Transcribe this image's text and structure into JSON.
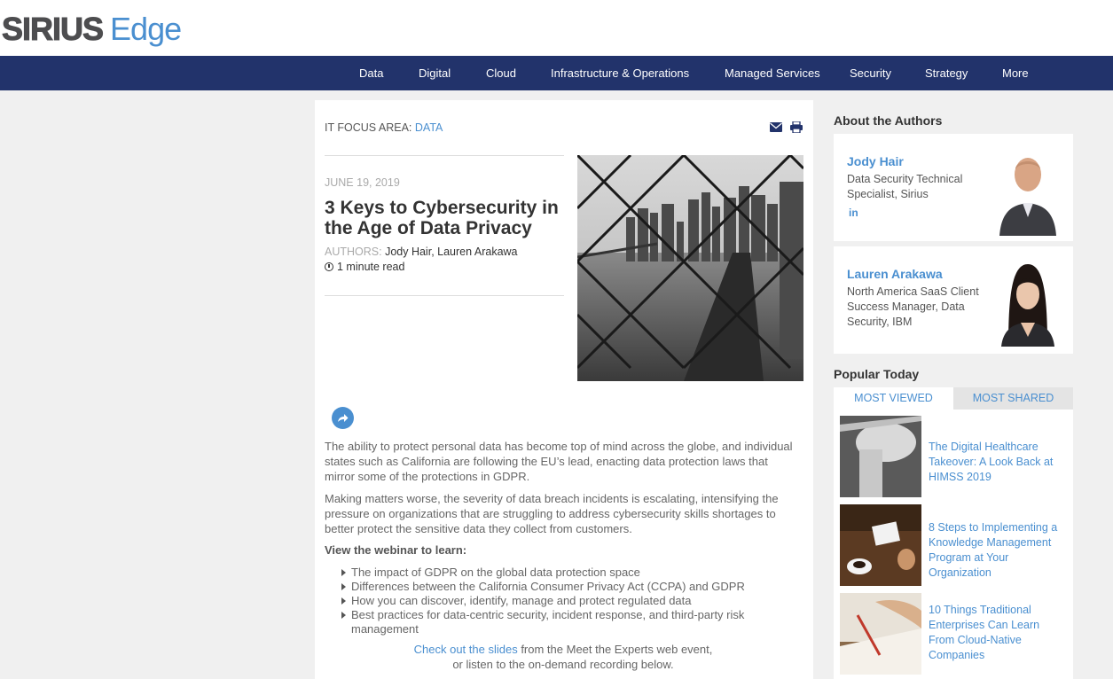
{
  "brand": {
    "name_bold": "SIRIUS",
    "name_light": "Edge"
  },
  "nav": {
    "items": [
      {
        "label": "Data"
      },
      {
        "label": "Digital"
      },
      {
        "label": "Cloud"
      },
      {
        "label": "Infrastructure & Operations"
      },
      {
        "label": "Managed Services"
      },
      {
        "label": "Security"
      },
      {
        "label": "Strategy"
      },
      {
        "label": "More"
      }
    ]
  },
  "article": {
    "focus_label": "IT FOCUS AREA:",
    "focus_value": "DATA",
    "date": "JUNE 19, 2019",
    "title": "3 Keys to Cybersecurity in the Age of Data Privacy",
    "authors_label": "AUTHORS:",
    "author_1": "Jody Hair",
    "author_sep": ",",
    "author_2": "Lauren Arakawa",
    "read_time": "1 minute read",
    "paragraph_1": "The ability to protect personal data has become top of mind across the globe, and individual states such as California are following the EU’s lead, enacting data protection laws that mirror some of the protections in GDPR.",
    "paragraph_2": "Making matters worse, the severity of data breach incidents is escalating, intensifying the pressure on organizations that are struggling to address cybersecurity skills shortages to better protect the sensitive data they collect from customers.",
    "learn_heading": "View the webinar to learn:",
    "bullets": [
      "The impact of GDPR on the global data protection space",
      "Differences between the California Consumer Privacy Act (CCPA) and GDPR",
      "How you can discover, identify, manage and protect regulated data",
      "Best practices for data-centric security, incident response, and third-party risk management"
    ],
    "cta_link": "Check out the slides",
    "cta_rest": " from the Meet the Experts web event,",
    "cta_line2": "or listen to the on-demand recording below."
  },
  "sidebar": {
    "authors_heading": "About the Authors",
    "authors": [
      {
        "name": "Jody Hair",
        "role": "Data Security Technical Specialist, Sirius",
        "social": "in"
      },
      {
        "name": "Lauren Arakawa",
        "role": "North America SaaS Client Success Manager, Data Security, IBM"
      }
    ],
    "popular_heading": "Popular Today",
    "tabs": [
      {
        "label": "MOST VIEWED"
      },
      {
        "label": "MOST SHARED"
      }
    ],
    "popular": [
      {
        "title": "The Digital Healthcare Takeover: A Look Back at HIMSS 2019"
      },
      {
        "title": "8 Steps to Implementing a Knowledge Management Program at Your Organization"
      },
      {
        "title": "10 Things Traditional Enterprises Can Learn From Cloud-Native Companies"
      }
    ]
  }
}
